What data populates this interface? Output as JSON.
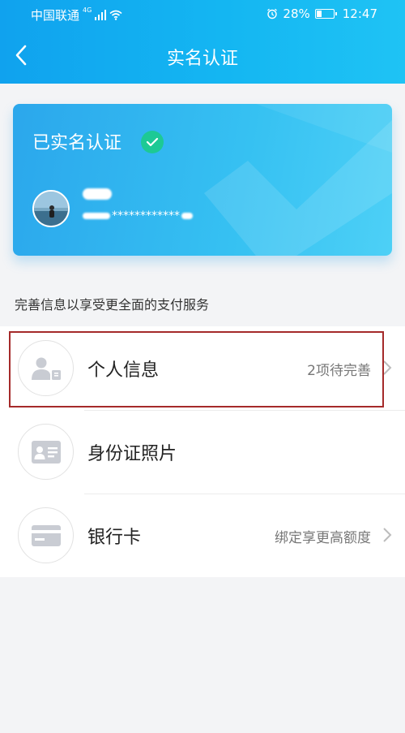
{
  "status_bar": {
    "carrier": "中国联通",
    "network": "4G",
    "battery": "28%",
    "time": "12:47"
  },
  "nav": {
    "title": "实名认证",
    "back_icon": "chevron-left-icon"
  },
  "card": {
    "title": "已实名认证",
    "badge_icon": "check-circle-icon",
    "id_masked": "************"
  },
  "hint": "完善信息以享受更全面的支付服务",
  "list": {
    "items": [
      {
        "label": "个人信息",
        "value": "2项待完善",
        "icon": "person-card-icon"
      },
      {
        "label": "身份证照片",
        "value": "",
        "icon": "id-card-icon"
      },
      {
        "label": "银行卡",
        "value": "绑定享更高额度",
        "icon": "bank-card-icon"
      }
    ]
  },
  "colors": {
    "header_start": "#10a2ee",
    "header_end": "#1fc3f4",
    "badge": "#1dc995",
    "highlight": "#a52a2a"
  }
}
